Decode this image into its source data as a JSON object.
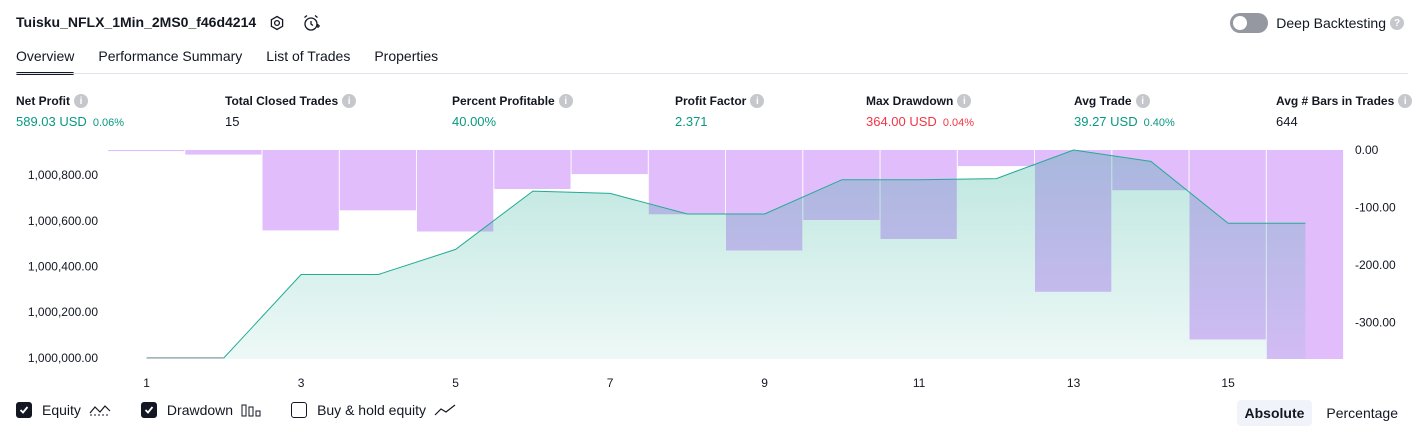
{
  "header": {
    "title": "Tuisku_NFLX_1Min_2MS0_f46d4214",
    "settings_icon": "gear-icon",
    "alert_icon": "alarm-clock-plus-icon",
    "deep_backtesting_label": "Deep Backtesting",
    "deep_backtesting_enabled": false
  },
  "tabs": [
    {
      "label": "Overview",
      "active": true
    },
    {
      "label": "Performance Summary",
      "active": false
    },
    {
      "label": "List of Trades",
      "active": false
    },
    {
      "label": "Properties",
      "active": false
    }
  ],
  "stats": [
    {
      "label": "Net Profit",
      "value": "589.03 USD",
      "pct": "0.06%",
      "tone": "pos"
    },
    {
      "label": "Total Closed Trades",
      "value": "15",
      "pct": "",
      "tone": "plain"
    },
    {
      "label": "Percent Profitable",
      "value": "40.00%",
      "pct": "",
      "tone": "pos"
    },
    {
      "label": "Profit Factor",
      "value": "2.371",
      "pct": "",
      "tone": "pos"
    },
    {
      "label": "Max Drawdown",
      "value": "364.00 USD",
      "pct": "0.04%",
      "tone": "neg"
    },
    {
      "label": "Avg Trade",
      "value": "39.27 USD",
      "pct": "0.40%",
      "tone": "pos"
    },
    {
      "label": "Avg # Bars in Trades",
      "value": "644",
      "pct": "",
      "tone": "plain"
    }
  ],
  "colors": {
    "equity_line": "#22ab94",
    "drawdown_bar": "#e1bdfc",
    "positive": "#089981",
    "negative": "#f23645"
  },
  "chart_data": {
    "type": "bar",
    "x": [
      1,
      2,
      3,
      4,
      5,
      6,
      7,
      8,
      9,
      10,
      11,
      12,
      13,
      14,
      15,
      16
    ],
    "x_ticks": [
      "1",
      "3",
      "5",
      "7",
      "9",
      "11",
      "13",
      "15"
    ],
    "equity": [
      1000000,
      1000000,
      1000365,
      1000365,
      1000475,
      1000730,
      1000720,
      1000630,
      1000630,
      1000780,
      1000780,
      1000785,
      1000910,
      1000860,
      1000589,
      1000589
    ],
    "drawdown": [
      -2,
      -8,
      -140,
      -105,
      -142,
      -68,
      -42,
      -112,
      -175,
      -122,
      -155,
      -28,
      -247,
      -70,
      -330,
      -364
    ],
    "y_left_ticks": [
      "1,000,000.00",
      "1,000,200.00",
      "1,000,400.00",
      "1,000,600.00",
      "1,000,800.00"
    ],
    "y_right_ticks": [
      "0.00",
      "-100.00",
      "-200.00",
      "-300.00"
    ],
    "left_range": [
      999995,
      1000910
    ],
    "right_range": [
      -364,
      0
    ],
    "series": [
      {
        "name": "Equity",
        "type": "area-line"
      },
      {
        "name": "Drawdown",
        "type": "bar"
      }
    ]
  },
  "legend": {
    "equity": {
      "label": "Equity",
      "checked": true,
      "icon": "equity-line-icon"
    },
    "drawdown": {
      "label": "Drawdown",
      "checked": true,
      "icon": "bars-icon"
    },
    "buyhold": {
      "label": "Buy & hold equity",
      "checked": false,
      "icon": "trend-line-icon"
    }
  },
  "mode": {
    "absolute": "Absolute",
    "percentage": "Percentage",
    "selected": "absolute"
  }
}
